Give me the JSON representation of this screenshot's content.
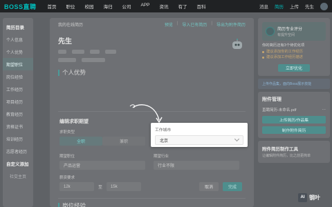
{
  "nav": {
    "logo": "BOSS直聘",
    "items": [
      "首页",
      "职位",
      "校园",
      "海归",
      "公司",
      "APP",
      "资讯",
      "有了",
      "百科"
    ],
    "right": [
      "消息",
      "简历",
      "上传",
      "先生"
    ]
  },
  "sidebar": {
    "title": "简历目录",
    "items": [
      "个人信息",
      "个人优势",
      "期望职位",
      "岗位经验",
      "工作经历",
      "项目经历",
      "教育经历",
      "资格证书",
      "培训经历",
      "志愿者经历"
    ],
    "custom_title": "自定义添加",
    "custom_item": "社交主页"
  },
  "main": {
    "header": "我的在线简历",
    "links": [
      "预览",
      "导入已有简历",
      "导出为附件简历"
    ],
    "name": "先生",
    "section_advantage": "个人优势",
    "edit_title": "编辑求职期望",
    "job_type_label": "求职类型",
    "job_type_options": [
      "全职",
      "兼职"
    ],
    "position_label": "期望职位",
    "position_value": "产品运营",
    "industry_label": "期望行业",
    "industry_value": "行业不限",
    "salary_label": "薪资要求",
    "salary_min": "12k",
    "salary_to": "至",
    "salary_max": "15k",
    "cancel": "取消",
    "done": "完成",
    "section_experience": "岗位经验"
  },
  "popup": {
    "label": "工作城市",
    "value": "北京"
  },
  "right": {
    "score_title": "简历专业评分",
    "score_sub": "有提升空间",
    "tip_intro": "你的简历还有3个待优化项",
    "tips": [
      "建议添加你的工作经历",
      "建议添加工作经历描述"
    ],
    "optimize": "立即优化",
    "hint": "上传作品集，面向Boss展示技能",
    "att_title": "附件管理",
    "att_file": "直聘简历-未命名.pdf",
    "btn_upload": "上传简历/作品集",
    "btn_make": "制作附件简历",
    "tool_title": "附件简历制作工具",
    "tool_desc": "让编辑附件简历，比之前更简单"
  },
  "badge": {
    "ai": "AI",
    "text": "钢叶"
  }
}
